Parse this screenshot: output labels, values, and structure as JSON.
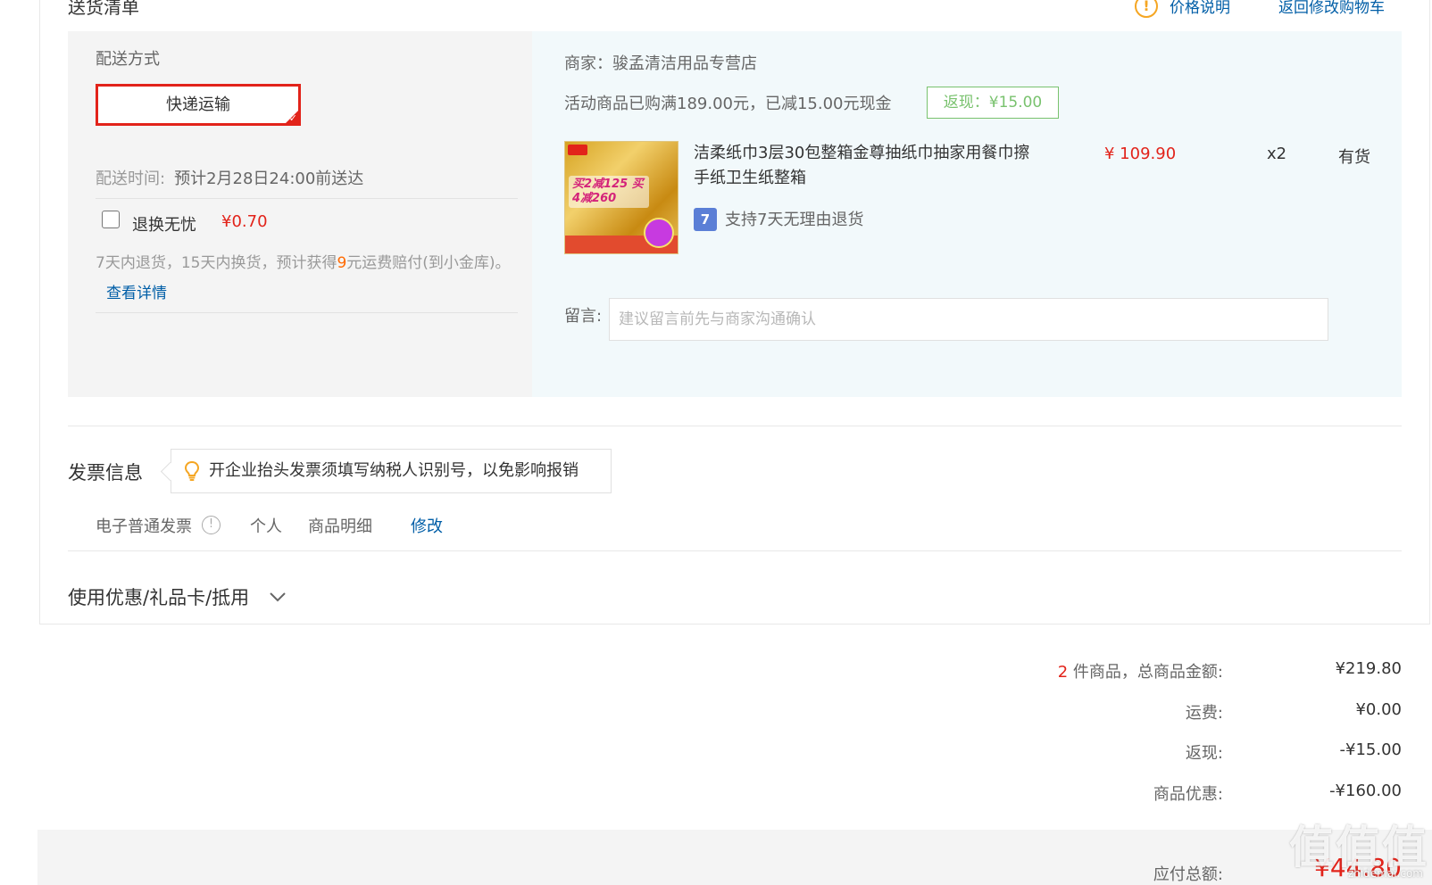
{
  "header": {
    "section_title": "送货清单",
    "price_note": "价格说明",
    "back_to_cart": "返回修改购物车"
  },
  "delivery": {
    "method_label": "配送方式",
    "method_selected": "快递运输",
    "time_label": "配送时间:",
    "time_value": "预计2月28日24:00前送达",
    "return_option_label": "退换无忧",
    "return_option_price": "¥0.70",
    "return_option_checked": false,
    "return_desc_prefix": "7天内退货，15天内换货，预计获得",
    "return_desc_amount": "9",
    "return_desc_suffix": "元运费赔付(到小金库)。",
    "return_details_link": "查看详情"
  },
  "order": {
    "vendor": "商家：骏孟清洁用品专营店",
    "promo_text": "活动商品已购满189.00元，已减15.00元现金",
    "cashback_tag": "返现：¥15.00",
    "product": {
      "name": "洁柔纸巾3层30包整箱金尊抽纸巾抽家用餐巾擦手纸卫生纸整箱",
      "price": "¥ 109.90",
      "quantity": "x2",
      "stock": "有货",
      "image_promo": "买2减125 买4减260",
      "return_badge": "7",
      "return_policy": "支持7天无理由退货"
    },
    "memo_label": "留言:",
    "memo_placeholder": "建议留言前先与商家沟通确认"
  },
  "invoice": {
    "title": "发票信息",
    "tip": "开企业抬头发票须填写纳税人识别号，以免影响报销",
    "type": "电子普通发票",
    "title_type": "个人",
    "content": "商品明细",
    "edit": "修改"
  },
  "coupon": {
    "title": "使用优惠/礼品卡/抵用"
  },
  "summary": {
    "item_count": "2",
    "item_label": " 件商品，总商品金额:",
    "item_total": "¥219.80",
    "shipping_label": "运费:",
    "shipping_value": "¥0.00",
    "cashback_label": "返现:",
    "cashback_value": "-¥15.00",
    "discount_label": "商品优惠:",
    "discount_value": "-¥160.00",
    "total_label": "应付总额:",
    "total_value": "¥44.80"
  },
  "watermark": {
    "logo": "值值值",
    "url": "zhidemai.com"
  },
  "colors": {
    "accent_red": "#e2231a",
    "link_blue": "#005ea7",
    "cashback_green": "#79c26e",
    "orange": "#ff6a00"
  }
}
